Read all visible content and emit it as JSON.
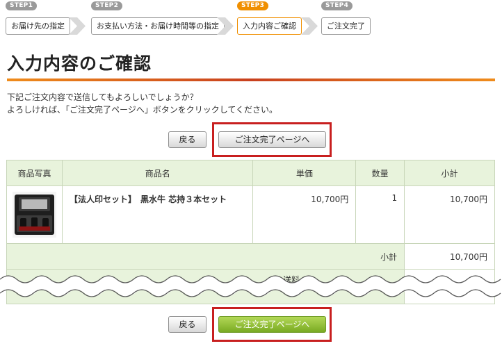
{
  "steps": [
    {
      "tag": "STEP1",
      "label": "お届け先の指定",
      "active": false
    },
    {
      "tag": "STEP2",
      "label": "お支払い方法・お届け時間等の指定",
      "active": false
    },
    {
      "tag": "STEP3",
      "label": "入力内容ご確認",
      "active": true
    },
    {
      "tag": "STEP4",
      "label": "ご注文完了",
      "active": false
    }
  ],
  "page_title": "入力内容のご確認",
  "intro": {
    "line1": "下記ご注文内容で送信してもよろしいでしょうか？",
    "line2": "よろしければ、「ご注文完了ページへ」ボタンをクリックしてください。"
  },
  "buttons": {
    "back": "戻る",
    "complete": "ご注文完了ページへ"
  },
  "table": {
    "headers": [
      "商品写真",
      "商品名",
      "単価",
      "数量",
      "小計"
    ],
    "row": {
      "name": "【法人印セット】　黒水牛 芯持３本セット",
      "unit_price": "10,700円",
      "quantity": "1",
      "subtotal": "10,700円"
    },
    "subtotal_label": "小計",
    "subtotal_value": "10,700円",
    "cut_label": "送料"
  },
  "colors": {
    "step_active": "#f08f00",
    "step_inactive": "#9a9a9a",
    "highlight": "#c81f1f",
    "header_bg": "#e8f3dc",
    "green_button": "#79aa22"
  }
}
